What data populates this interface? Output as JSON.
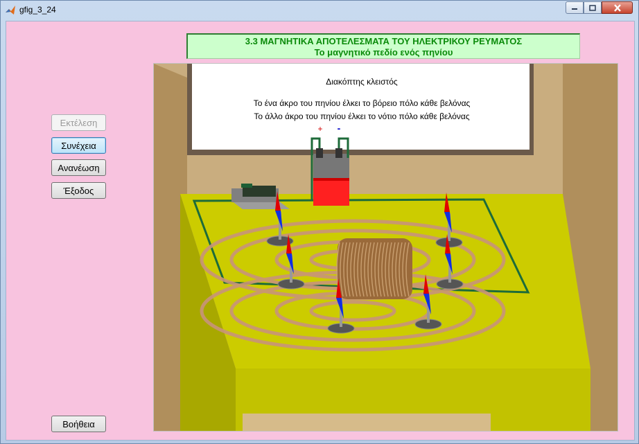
{
  "window": {
    "title": "gfig_3_24"
  },
  "header": {
    "line1": "3.3 ΜΑΓΝΗΤΙΚΑ ΑΠΟΤΕΛΕΣΜΑΤΑ ΤΟΥ ΗΛΕΚΤΡΙΚΟΥ ΡΕΥΜΑΤΟΣ",
    "line2": "Το μαγνητικό πεδίο ενός πηνίου"
  },
  "buttons": {
    "run": "Εκτέλεση",
    "continue": "Συνέχεια",
    "refresh": "Ανανέωση",
    "exit": "Έξοδος",
    "help": "Βοήθεια"
  },
  "board": {
    "switch_state": "Διακόπτης κλειστός",
    "line1": "Το ένα άκρο του πηνίου έλκει το βόρειο πόλο κάθε βελόνας",
    "line2": "Το άλλο άκρο του πηνίου έλκει το νότιο πόλο κάθε βελόνας"
  },
  "battery": {
    "plus": "+",
    "minus": "-"
  },
  "icons": {
    "app": "matlab-icon",
    "minimize": "minimize-icon",
    "maximize": "maximize-icon",
    "close": "close-icon"
  },
  "colors": {
    "background": "#f8c3df",
    "header_bg": "#ccffcc",
    "header_text": "#0a8a0a",
    "table": "#cccc00",
    "wall": "#c9ad7f"
  }
}
